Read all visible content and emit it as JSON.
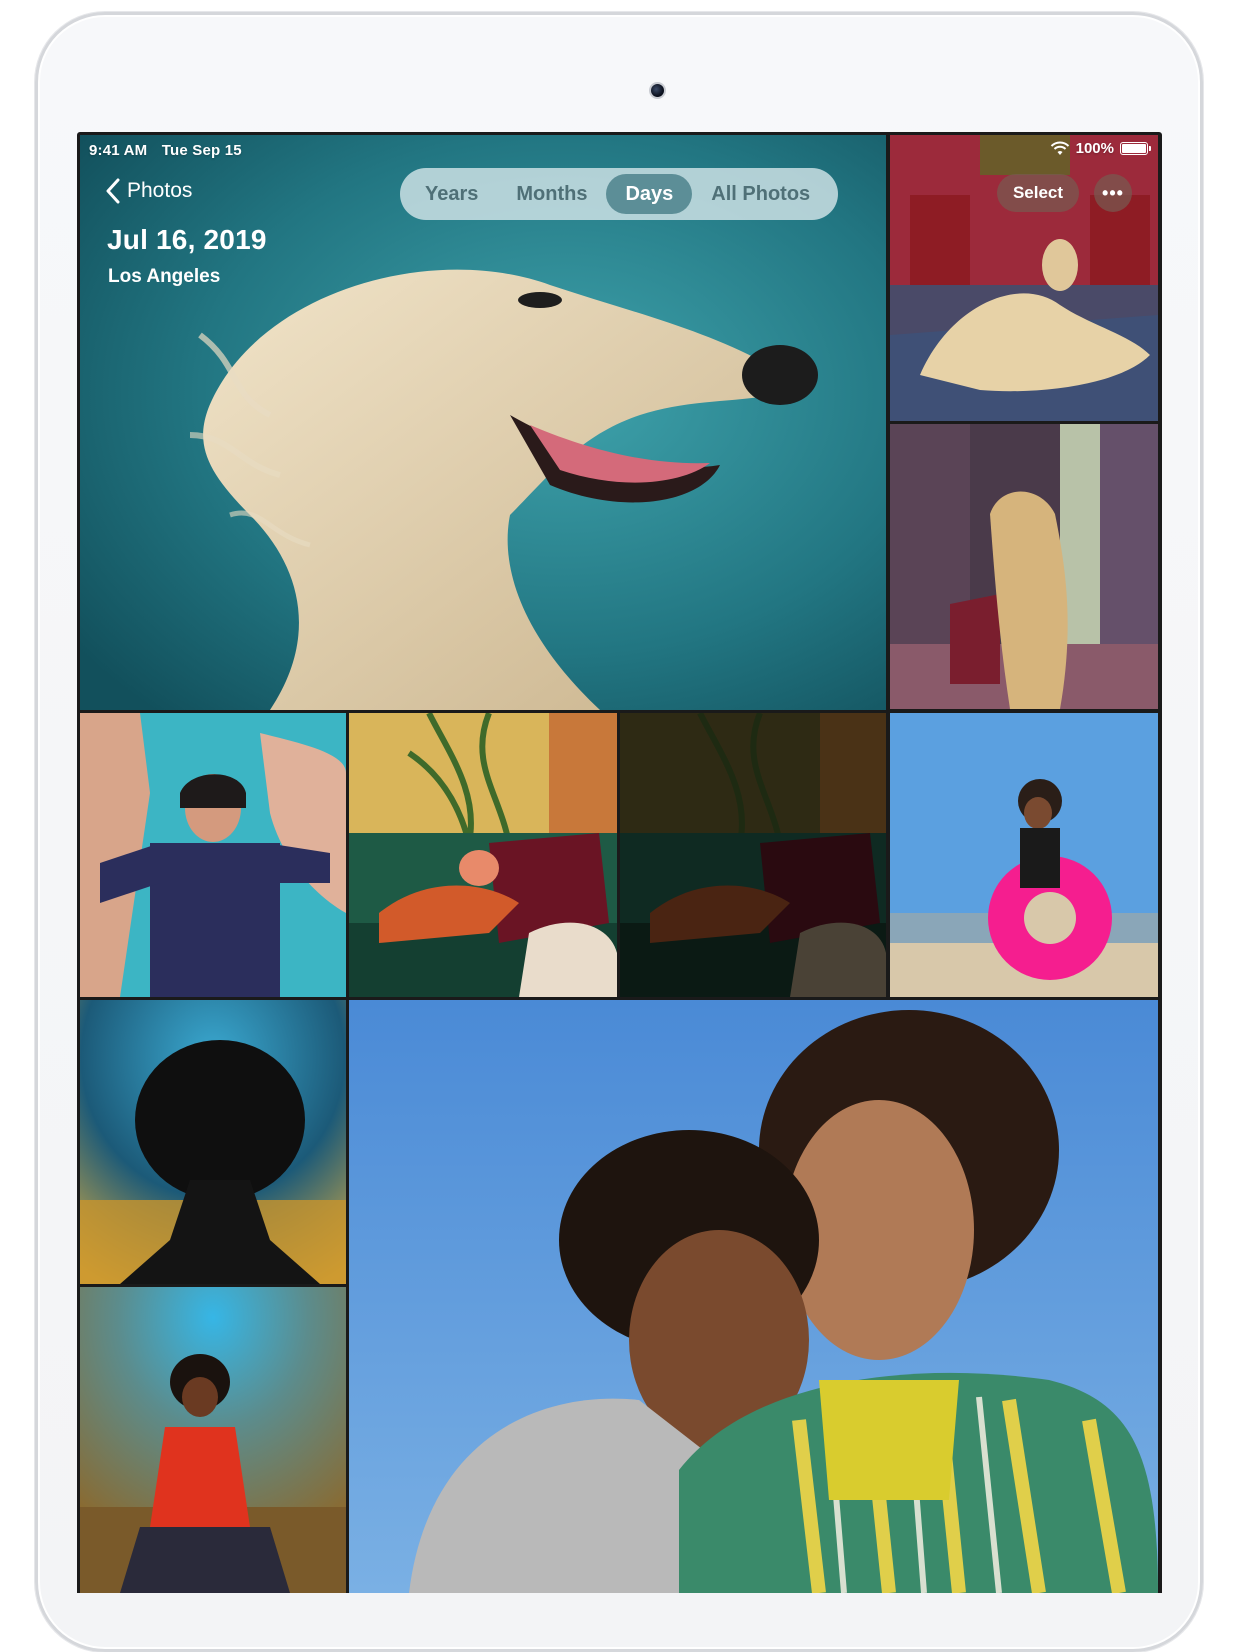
{
  "status_bar": {
    "time": "9:41 AM",
    "date": "Tue Sep 15",
    "battery": "100%"
  },
  "nav": {
    "back_label": "Photos"
  },
  "header": {
    "date": "Jul 16, 2019",
    "location": "Los Angeles"
  },
  "view_tabs": [
    {
      "label": "Years",
      "active": false
    },
    {
      "label": "Months",
      "active": false
    },
    {
      "label": "Days",
      "active": true
    },
    {
      "label": "All Photos",
      "active": false
    }
  ],
  "toolbar": {
    "select_label": "Select",
    "more_label": "•••"
  },
  "colors": {
    "tab_bar_bg": "#d2e4e8",
    "tab_active_bg": "#5c8e97",
    "tab_text": "#4f7077"
  },
  "icons": [
    "camera-lens-icon",
    "chevron-left-icon",
    "wifi-icon",
    "battery-icon",
    "ellipsis-icon"
  ]
}
